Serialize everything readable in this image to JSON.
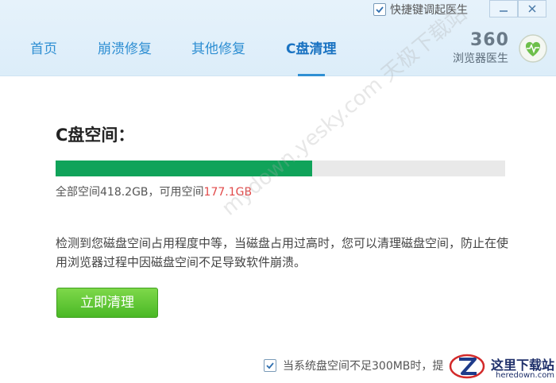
{
  "window": {
    "shortcut_label": "快捷键调起医生",
    "shortcut_checked": true
  },
  "nav": {
    "items": [
      {
        "label": "首页"
      },
      {
        "label": "崩溃修复"
      },
      {
        "label": "其他修复"
      },
      {
        "label": "C盘清理",
        "active": true
      }
    ]
  },
  "brand": {
    "number": "360",
    "name": "浏览器医生"
  },
  "disk": {
    "title": "C盘空间：",
    "usage_fraction": 0.57,
    "total_prefix": "全部空间418.2GB，可用空间",
    "free_value": "177.1GB"
  },
  "description": "检测到您磁盘空间占用程度中等，当磁盘占用过高时，您可以清理磁盘空间，防止在使用浏览器过程中因磁盘空间不足导致软件崩溃。",
  "actions": {
    "clean_label": "立即清理"
  },
  "auto_option": {
    "label": "当系统盘空间不足300MB时，提",
    "checked": true
  },
  "watermark": {
    "text": "mydown.yesky.com 天极下载站"
  },
  "site_badge": {
    "cn": "这里下载站",
    "en": "heredown.com"
  },
  "colors": {
    "accent": "#2f8fd3",
    "progress": "#10a35a",
    "free_space": "#e24a4a",
    "button": "#4ab825"
  }
}
